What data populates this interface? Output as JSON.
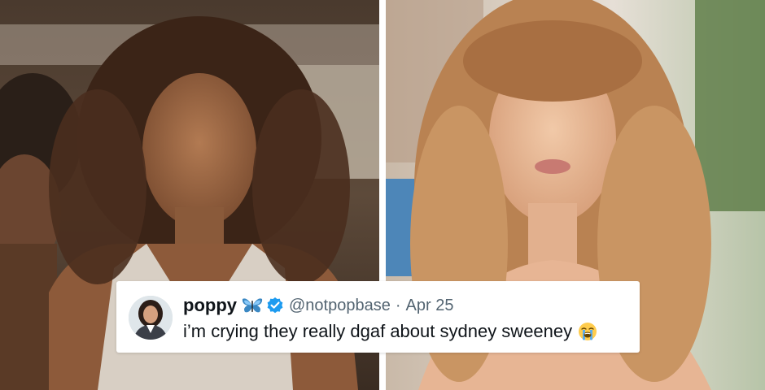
{
  "images": {
    "left_photo": "woman-with-curly-hair-in-tank-top-photo",
    "right_photo": "woman-with-wavy-blonde-hair-frowning-photo"
  },
  "tweet": {
    "display_name": "poppy",
    "name_emoji": "butterfly-emoji",
    "verified_icon": "verified-badge-icon",
    "handle": "@notpopbase",
    "separator": "·",
    "date": "Apr 25",
    "text": "i’m crying they really dgaf about sydney sweeney",
    "text_emoji": "loudly-crying-face-emoji",
    "colors": {
      "name": "#0f1419",
      "meta": "#536471",
      "verified": "#1d9bf0"
    }
  }
}
